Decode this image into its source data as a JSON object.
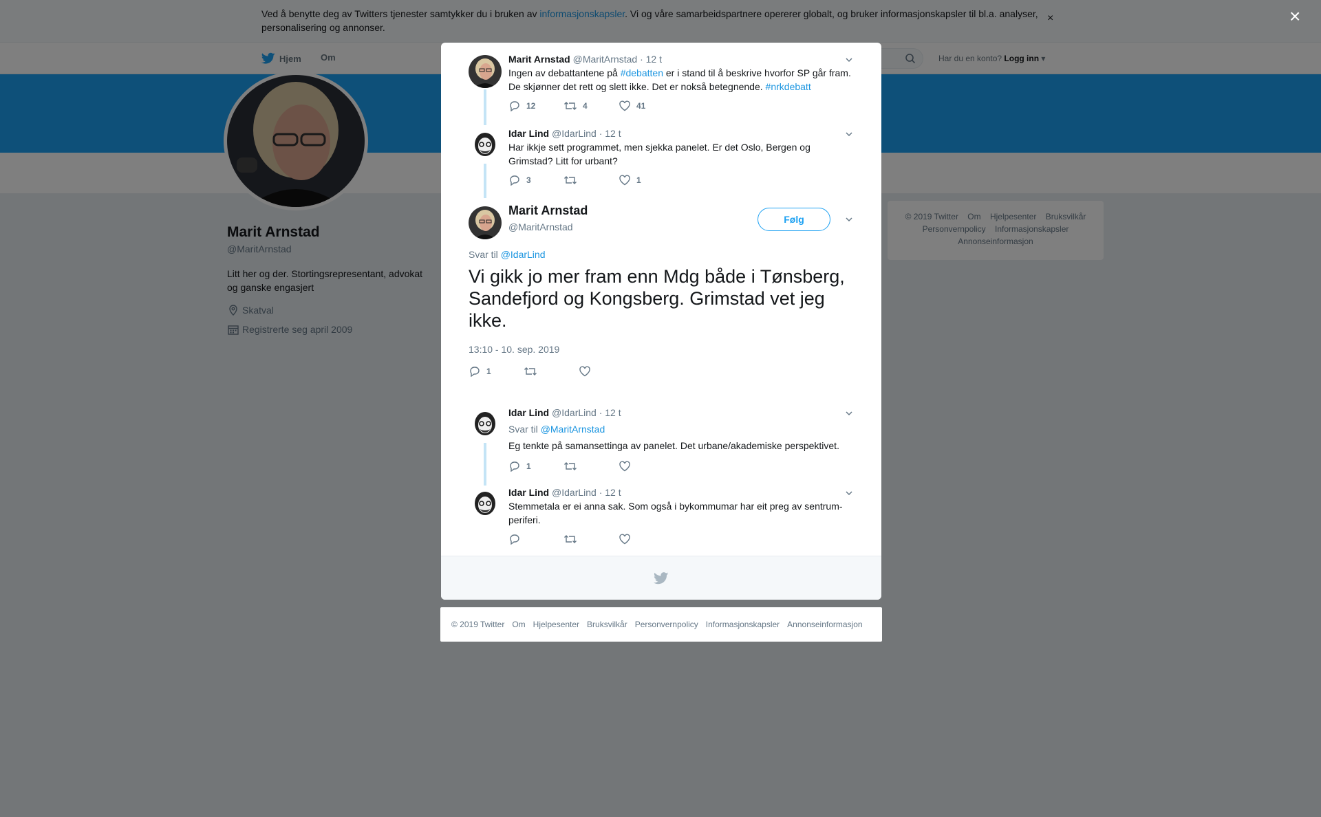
{
  "cookie_banner": {
    "text_before": "Ved å benytte deg av Twitters tjenester samtykker du i bruken av ",
    "link": "informasjonskapsler",
    "text_after": ". Vi og våre samarbeidspartnere opererer globalt, og bruker informasjonskapsler til bl.a. analyser, personalisering og annonser.",
    "close": "×"
  },
  "overlay_close": "×",
  "nav": {
    "home": "Hjem",
    "about": "Om",
    "have_account": "Har du en konto?",
    "login": "Logg inn"
  },
  "profile": {
    "name": "Marit Arnstad",
    "handle": "@MaritArnstad",
    "bio": "Litt her og der. Stortingsrepresentant, advokat og ganske engasjert",
    "location": "Skatval",
    "joined": "Registrerte seg april 2009"
  },
  "side_footer": {
    "links": [
      "© 2019 Twitter",
      "Om",
      "Hjelpesenter",
      "Bruksvilkår",
      "Personvernpolicy",
      "Informasjonskapsler",
      "Annonseinformasjon"
    ]
  },
  "thread": [
    {
      "name": "Marit Arnstad",
      "handle": "@MaritArnstad",
      "time": "· 12 t",
      "text_1": "Ingen av debattantene på ",
      "hashtag_1": "#debatten",
      "text_2": " er i stand til å beskrive hvorfor SP går fram. De skjønner det rett og slett ikke. Det er nokså betegnende. ",
      "hashtag_2": "#nrkdebatt",
      "replies": "12",
      "retweets": "4",
      "likes": "41"
    },
    {
      "name": "Idar Lind",
      "handle": "@IdarLind",
      "time": "· 12 t",
      "text": "Har ikkje sett programmet, men sjekka panelet. Er det Oslo, Bergen og Grimstad? Litt for urbant?",
      "replies": "3",
      "retweets": "",
      "likes": "1"
    }
  ],
  "main_tweet": {
    "name": "Marit Arnstad",
    "handle": "@MaritArnstad",
    "follow": "Følg",
    "reply_prefix": "Svar til ",
    "reply_to": "@IdarLind",
    "text": "Vi gikk jo mer fram enn Mdg både i Tønsberg, Sandefjord og Kongsberg. Grimstad vet jeg ikke.",
    "date": "13:10 - 10. sep. 2019",
    "replies": "1",
    "retweets": "",
    "likes": ""
  },
  "replies": [
    {
      "name": "Idar Lind",
      "handle": "@IdarLind",
      "time": "· 12 t",
      "reply_prefix": "Svar til ",
      "reply_to": "@MaritArnstad",
      "text": "Eg tenkte på samansettinga av panelet. Det urbane/akademiske perspektivet.",
      "replies": "1",
      "retweets": "",
      "likes": ""
    },
    {
      "name": "Idar Lind",
      "handle": "@IdarLind",
      "time": "· 12 t",
      "text": "Stemmetala er ei anna sak. Som også i bykommumar har eit preg av sentrum-periferi.",
      "replies": "",
      "retweets": "",
      "likes": ""
    }
  ],
  "bottom_footer": {
    "links": [
      "© 2019 Twitter",
      "Om",
      "Hjelpesenter",
      "Bruksvilkår",
      "Personvernpolicy",
      "Informasjonskapsler",
      "Annonseinformasjon"
    ]
  },
  "colors": {
    "brand": "#1da1f2",
    "link": "#1b95e0",
    "thread_line": "#c4e4f6",
    "overlay": "rgba(0,0,0,0.5)"
  },
  "icons": [
    "twitter-bird-icon",
    "search-icon",
    "location-icon",
    "calendar-icon",
    "reply-icon",
    "retweet-icon",
    "like-icon",
    "chevron-down-icon",
    "close-icon"
  ]
}
